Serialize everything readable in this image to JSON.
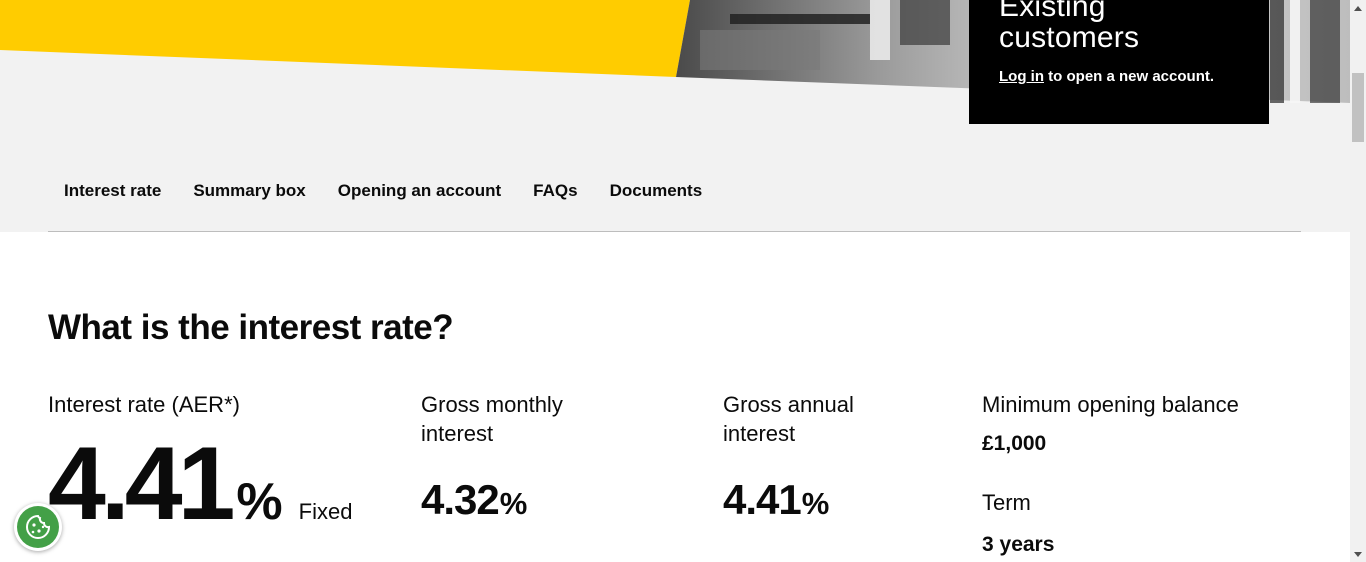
{
  "hero": {
    "accent_color": "#ffcc00",
    "login_box": {
      "title_line1": "Existing",
      "title_line2": "customers",
      "login_link": "Log in",
      "login_suffix": " to open a new account."
    }
  },
  "tabs": [
    "Interest rate",
    "Summary box",
    "Opening an account",
    "FAQs",
    "Documents"
  ],
  "section": {
    "heading": "What is the interest rate?",
    "interest_rate": {
      "label": "Interest rate (AER*)",
      "value": "4.41",
      "unit": "%",
      "type": "Fixed"
    },
    "gross_monthly": {
      "label_line1": "Gross monthly",
      "label_line2": "interest",
      "value": "4.32",
      "unit": "%"
    },
    "gross_annual": {
      "label_line1": "Gross annual",
      "label_line2": "interest",
      "value": "4.41",
      "unit": "%"
    },
    "minimum_balance": {
      "label": "Minimum opening balance",
      "value": "£1,000"
    },
    "term": {
      "label": "Term",
      "value": "3 years"
    }
  },
  "cookie_button": {
    "icon": "cookie-icon",
    "color": "#43a047"
  }
}
